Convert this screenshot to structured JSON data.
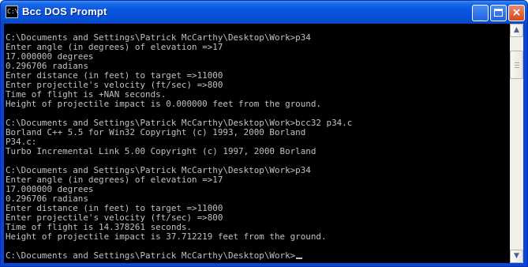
{
  "window": {
    "title": "Bcc DOS Prompt",
    "icon_text": "C:\\",
    "buttons": {
      "minimize": "_",
      "maximize": "",
      "close": "×"
    }
  },
  "console": {
    "lines": [
      "",
      "C:\\Documents and Settings\\Patrick McCarthy\\Desktop\\Work>p34",
      "Enter angle (in degrees) of elevation =>17",
      "17.000000 degrees",
      "0.296706 radians",
      "Enter distance (in feet) to target =>11000",
      "Enter projectile's velocity (ft/sec) =>800",
      "Time of flight is +NAN seconds.",
      "Height of projectile impact is 0.000000 feet from the ground.",
      "",
      "C:\\Documents and Settings\\Patrick McCarthy\\Desktop\\Work>bcc32 p34.c",
      "Borland C++ 5.5 for Win32 Copyright (c) 1993, 2000 Borland",
      "P34.c:",
      "Turbo Incremental Link 5.00 Copyright (c) 1997, 2000 Borland",
      "",
      "C:\\Documents and Settings\\Patrick McCarthy\\Desktop\\Work>p34",
      "Enter angle (in degrees) of elevation =>17",
      "17.000000 degrees",
      "0.296706 radians",
      "Enter distance (in feet) to target =>11000",
      "Enter projectile's velocity (ft/sec) =>800",
      "Time of flight is 14.378261 seconds.",
      "Height of projectile impact is 37.712219 feet from the ground.",
      "",
      "C:\\Documents and Settings\\Patrick McCarthy\\Desktop\\Work>"
    ]
  },
  "scrollbar": {
    "up_arrow": "▲",
    "down_arrow": "▼"
  },
  "colors": {
    "titlebar": "#0550d8",
    "console_bg": "#000000",
    "console_text": "#c0c0c0",
    "close_button": "#d24a20"
  }
}
